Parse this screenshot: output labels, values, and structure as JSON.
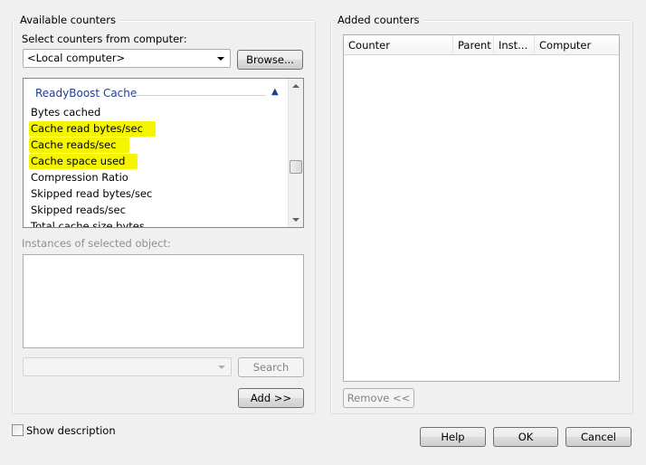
{
  "available": {
    "group_title": "Available counters",
    "select_label": "Select counters from computer:",
    "computer_value": "<Local computer>",
    "browse_label": "Browse...",
    "category": "ReadyBoost Cache",
    "counters": [
      {
        "label": "Bytes cached",
        "highlighted": false
      },
      {
        "label": "Cache read bytes/sec",
        "highlighted": true
      },
      {
        "label": "Cache reads/sec",
        "highlighted": true
      },
      {
        "label": "Cache space used",
        "highlighted": true
      },
      {
        "label": "Compression Ratio",
        "highlighted": false
      },
      {
        "label": "Skipped read bytes/sec",
        "highlighted": false
      },
      {
        "label": "Skipped reads/sec",
        "highlighted": false
      },
      {
        "label": "Total cache size bytes",
        "highlighted": false
      }
    ],
    "instances_label": "Instances of selected object:",
    "search_label": "Search",
    "add_label": "Add >>"
  },
  "added": {
    "group_title": "Added counters",
    "columns": [
      "Counter",
      "Parent",
      "Inst...",
      "Computer"
    ],
    "remove_label": "Remove <<"
  },
  "footer": {
    "show_description": "Show description",
    "show_description_checked": false,
    "help_label": "Help",
    "ok_label": "OK",
    "cancel_label": "Cancel"
  },
  "colors": {
    "highlight": "#f5f500",
    "category_text": "#1e3f8e"
  }
}
